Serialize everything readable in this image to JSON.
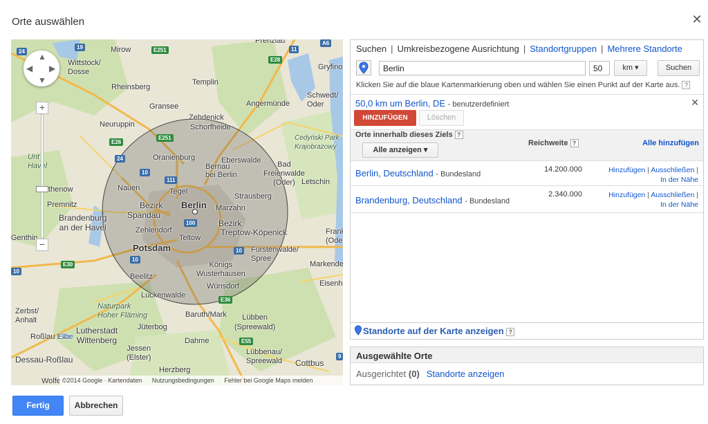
{
  "dialog": {
    "title": "Orte auswählen",
    "close_icon": "close-icon"
  },
  "map": {
    "labels": {
      "berlin": "Berlin",
      "potsdam": "Potsdam",
      "spandau": "Spandau",
      "bezirk_w": "Bezirk",
      "bezirk_e": "Bezirk",
      "oranienburg": "Oranienburg",
      "bernau": "Bernau\nbei Berlin",
      "strausberg": "Strausberg",
      "marzahn": "Marzahn",
      "treptow": "Treptow-Köpenick",
      "fuerstenwalde": "Fürstenwalde/\nSpree",
      "koenigs": "Königs\nWusterhausen",
      "wuensdorf": "Wünsdorf",
      "luckenwalde": "Luckenwalde",
      "teltow": "Teltow",
      "zehlendorf": "Zehlendorf",
      "nauen": "Nauen",
      "tegel": "Tegel",
      "beelitz": "Beelitz",
      "eberswalde": "Eberswalde",
      "bad_freienwalde": "Bad\nFreienwalde\n(Oder)",
      "letschin": "Letschin",
      "templin": "Templin",
      "angermuende": "Angermünde",
      "schwedt": "Schwedt/\nOder",
      "gryfino": "Gryfino",
      "prenzlau": "Prenzlau",
      "mirow": "Mirow",
      "wittstock": "Wittstock/\nDosse",
      "rheinsberg": "Rheinsberg",
      "gransee": "Gransee",
      "zehdenick": "Zehdenick",
      "schorfheide": "Schorfheide",
      "neuruppin": "Neuruppin",
      "unt_havel": "Unt\nHavel",
      "rathenow": "Rathenow",
      "premnitz": "Premnitz",
      "brandenburg": "Brandenburg\nan der Havel",
      "genthin": "Genthin",
      "zerbst": "Zerbst/\nAnhalt",
      "rosslau": "Roßlau Elbe",
      "lutherstadt": "Lutherstadt\nWittenberg",
      "dessau": "Dessau-Roßlau",
      "jueterbog": "Jüterbog",
      "baruth": "Baruth/Mark",
      "dahme": "Dahme",
      "luebben": "Lübben\n(Spreewald)",
      "jessen": "Jessen\n(Elster)",
      "herzberg": "Herzberg",
      "luebbenau": "Lübbenau/\nSpreewald",
      "cottbus": "Cottbus",
      "eisenh": "Eisenh",
      "markende": "Markende",
      "frankf": "Frankf\n(Ode",
      "wolfen": "Wolfe",
      "cedynski": "Cedyński Park\nKrajobrazowy",
      "naturpark": "Naturpark\nHoher Fläming",
      "elbe": "Elbe"
    },
    "shields": [
      "24",
      "19",
      "E251",
      "E28",
      "11",
      "A6",
      "E26",
      "24",
      "10",
      "E251",
      "111",
      "100",
      "10",
      "10",
      "E30",
      "10",
      "E36",
      "E55",
      "9"
    ],
    "footer": {
      "copyright": "©2014 Google · Kartendaten",
      "terms": "Nutzungsbedingungen",
      "report": "Fehler bei Google Maps melden"
    }
  },
  "panel": {
    "tabs": {
      "search": "Suchen",
      "radius": "Umkreisbezogene Ausrichtung",
      "groups": "Standortgruppen",
      "multi": "Mehrere Standorte"
    },
    "query": "Berlin",
    "radius_value": "50",
    "unit": "km",
    "search_button": "Suchen",
    "hint": "Klicken Sie auf die blaue Kartenmarkierung oben und wählen Sie einen Punkt auf der Karte aus.",
    "radius_title": "50,0 km um Berlin, DE",
    "radius_sub": "- benutzerdefiniert",
    "add_button": "HINZUFÜGEN",
    "delete_button": "Löschen",
    "table": {
      "col_places": "Orte innerhalb dieses Ziels",
      "col_reach": "Reichweite",
      "add_all": "Alle hinzufügen",
      "filter": "Alle anzeigen",
      "rows": [
        {
          "name": "Berlin, Deutschland",
          "type": "- Bundesland",
          "reach": "14.200.000",
          "add": "Hinzufügen",
          "exclude": "Ausschließen",
          "near": "In der Nähe"
        },
        {
          "name": "Brandenburg, Deutschland",
          "type": "- Bundesland",
          "reach": "2.340.000",
          "add": "Hinzufügen",
          "exclude": "Ausschließen",
          "near": "In der Nähe"
        }
      ]
    },
    "show_on_map": "Standorte auf der Karte anzeigen"
  },
  "selected": {
    "title": "Ausgewählte Orte",
    "targeted_label": "Ausgerichtet",
    "count": "(0)",
    "show_link": "Standorte anzeigen"
  },
  "footer": {
    "done": "Fertig",
    "cancel": "Abbrechen"
  },
  "colors": {
    "accent_blue": "#4285f4",
    "link": "#1155cc",
    "add_red": "#d14836",
    "map_bg": "#e8e4d2"
  }
}
